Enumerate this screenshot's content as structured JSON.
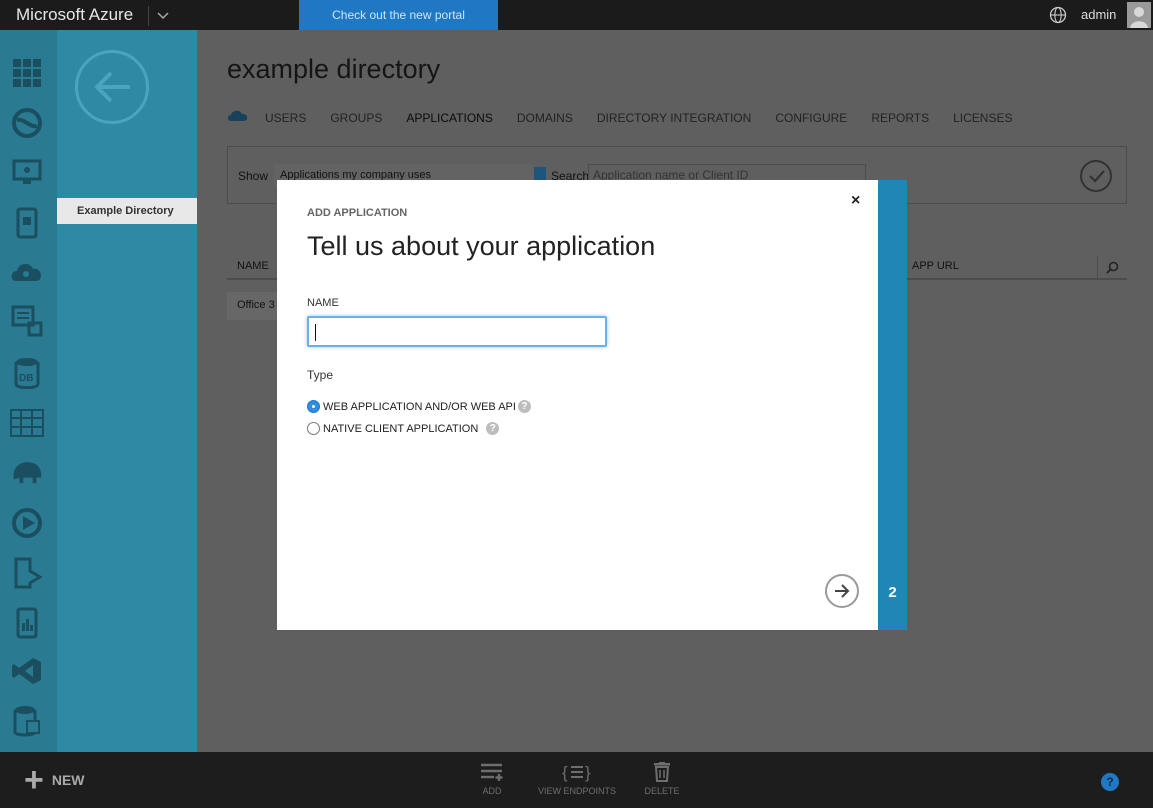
{
  "topbar": {
    "brand": "Microsoft Azure",
    "portal_link": "Check out the new portal",
    "user": "admin"
  },
  "subnav": {
    "directory_item": "Example Directory"
  },
  "main": {
    "title": "example directory",
    "tabs": [
      {
        "label": "USERS"
      },
      {
        "label": "GROUPS"
      },
      {
        "label": "APPLICATIONS",
        "active": true
      },
      {
        "label": "DOMAINS"
      },
      {
        "label": "DIRECTORY INTEGRATION"
      },
      {
        "label": "CONFIGURE"
      },
      {
        "label": "REPORTS"
      },
      {
        "label": "LICENSES"
      }
    ],
    "filter": {
      "show_label": "Show",
      "show_value": "Applications my company uses",
      "search_label": "Search",
      "search_placeholder": "Application name or Client ID"
    },
    "table": {
      "columns": [
        "NAME",
        "APP URL"
      ],
      "rows": [
        {
          "name": "Office 3"
        }
      ]
    }
  },
  "bottombar": {
    "new_label": "NEW",
    "commands": [
      {
        "label": "ADD"
      },
      {
        "label": "VIEW ENDPOINTS"
      },
      {
        "label": "DELETE"
      }
    ],
    "help": "?"
  },
  "modal": {
    "caption": "ADD APPLICATION",
    "title": "Tell us about your application",
    "name_label": "NAME",
    "name_value": "",
    "type_label": "Type",
    "options": [
      {
        "label": "WEB APPLICATION AND/OR WEB API",
        "checked": true
      },
      {
        "label": "NATIVE CLIENT APPLICATION",
        "checked": false
      }
    ],
    "close": "×",
    "step": "2"
  },
  "colors": {
    "accent": "#1f78c1",
    "rail": "#2a7a92",
    "subnav": "#2e8aa4",
    "modal_side": "#1f86b5"
  }
}
